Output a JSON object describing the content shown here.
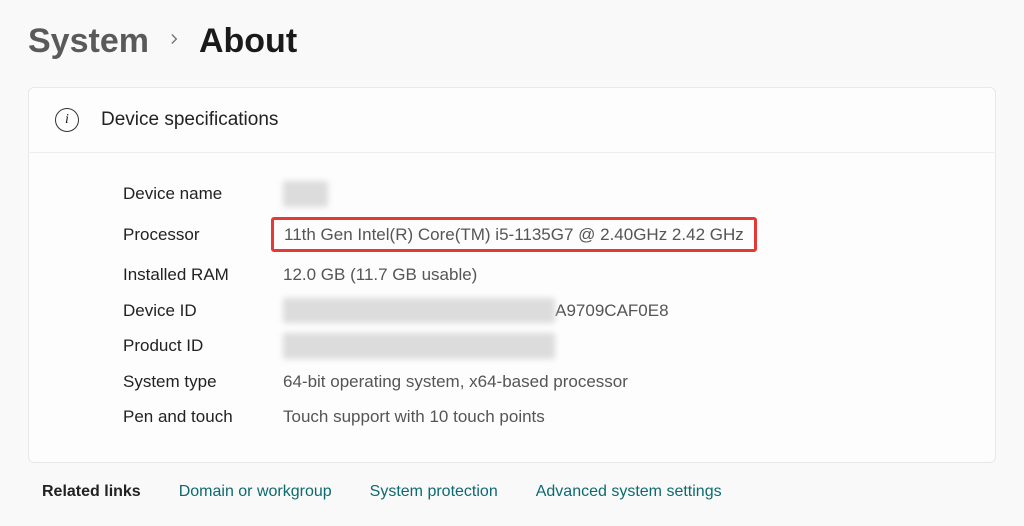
{
  "breadcrumb": {
    "parent": "System",
    "current": "About"
  },
  "card": {
    "title": "Device specifications"
  },
  "specs": {
    "device_name": {
      "label": "Device name",
      "value": "XXXX"
    },
    "processor": {
      "label": "Processor",
      "value": "11th Gen Intel(R) Core(TM) i5-1135G7 @ 2.40GHz   2.42 GHz"
    },
    "installed_ram": {
      "label": "Installed RAM",
      "value": "12.0 GB (11.7 GB usable)"
    },
    "device_id": {
      "label": "Device ID",
      "prefix": "XXXXXXXXXXXXXXXXXXXXXXXX",
      "suffix": "A9709CAF0E8"
    },
    "product_id": {
      "label": "Product ID",
      "value": "XXXXXXXXXXXXXXXXXXXXXXXX"
    },
    "system_type": {
      "label": "System type",
      "value": "64-bit operating system, x64-based processor"
    },
    "pen_touch": {
      "label": "Pen and touch",
      "value": "Touch support with 10 touch points"
    }
  },
  "footer": {
    "title": "Related links",
    "links": {
      "domain": "Domain or workgroup",
      "protect": "System protection",
      "advanced": "Advanced system settings"
    }
  }
}
